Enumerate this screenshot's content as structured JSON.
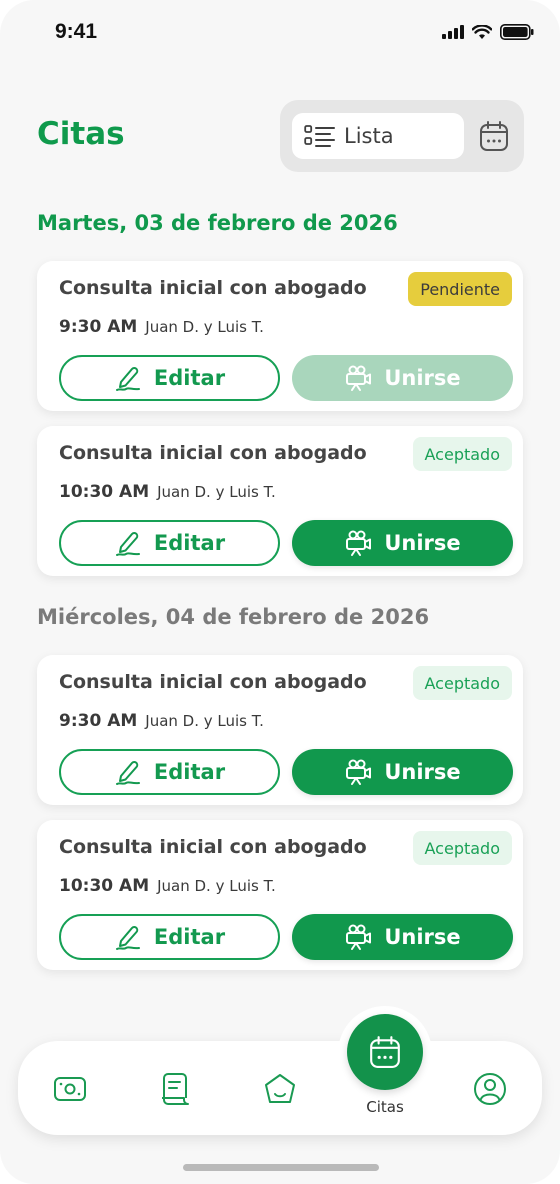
{
  "status_bar": {
    "time": "9:41"
  },
  "header": {
    "title": "Citas",
    "view_list_label": "Lista"
  },
  "days": [
    {
      "heading": "Martes, 03 de febrero de 2026",
      "heading_color": "#10994c",
      "appointments": [
        {
          "title": "Consulta inicial con abogado",
          "status": "Pendiente",
          "time": "9:30 AM",
          "people": "Juan D. y Luis T.",
          "edit_label": "Editar",
          "join_label": "Unirse",
          "join_enabled": false
        },
        {
          "title": "Consulta inicial con abogado",
          "status": "Aceptado",
          "time": "10:30 AM",
          "people": "Juan D. y Luis T.",
          "edit_label": "Editar",
          "join_label": "Unirse",
          "join_enabled": true
        }
      ]
    },
    {
      "heading": "Miércoles, 04 de febrero de 2026",
      "heading_color": "#7a7a7a",
      "appointments": [
        {
          "title": "Consulta inicial con abogado",
          "status": "Aceptado",
          "time": "9:30 AM",
          "people": "Juan D. y Luis T.",
          "edit_label": "Editar",
          "join_label": "Unirse",
          "join_enabled": true
        },
        {
          "title": "Consulta inicial con abogado",
          "status": "Aceptado",
          "time": "10:30 AM",
          "people": "Juan D. y Luis T.",
          "edit_label": "Editar",
          "join_label": "Unirse",
          "join_enabled": true
        }
      ]
    }
  ],
  "bottom_nav": {
    "items": [
      {
        "icon": "money-icon"
      },
      {
        "icon": "document-icon"
      },
      {
        "icon": "home-icon"
      },
      {
        "icon": "calendar-icon",
        "label": "Citas",
        "active": true
      },
      {
        "icon": "profile-icon"
      }
    ]
  },
  "colors": {
    "accent": "#11984d",
    "pending": "#e6cd3d",
    "accepted_bg": "#e7f6ec"
  }
}
